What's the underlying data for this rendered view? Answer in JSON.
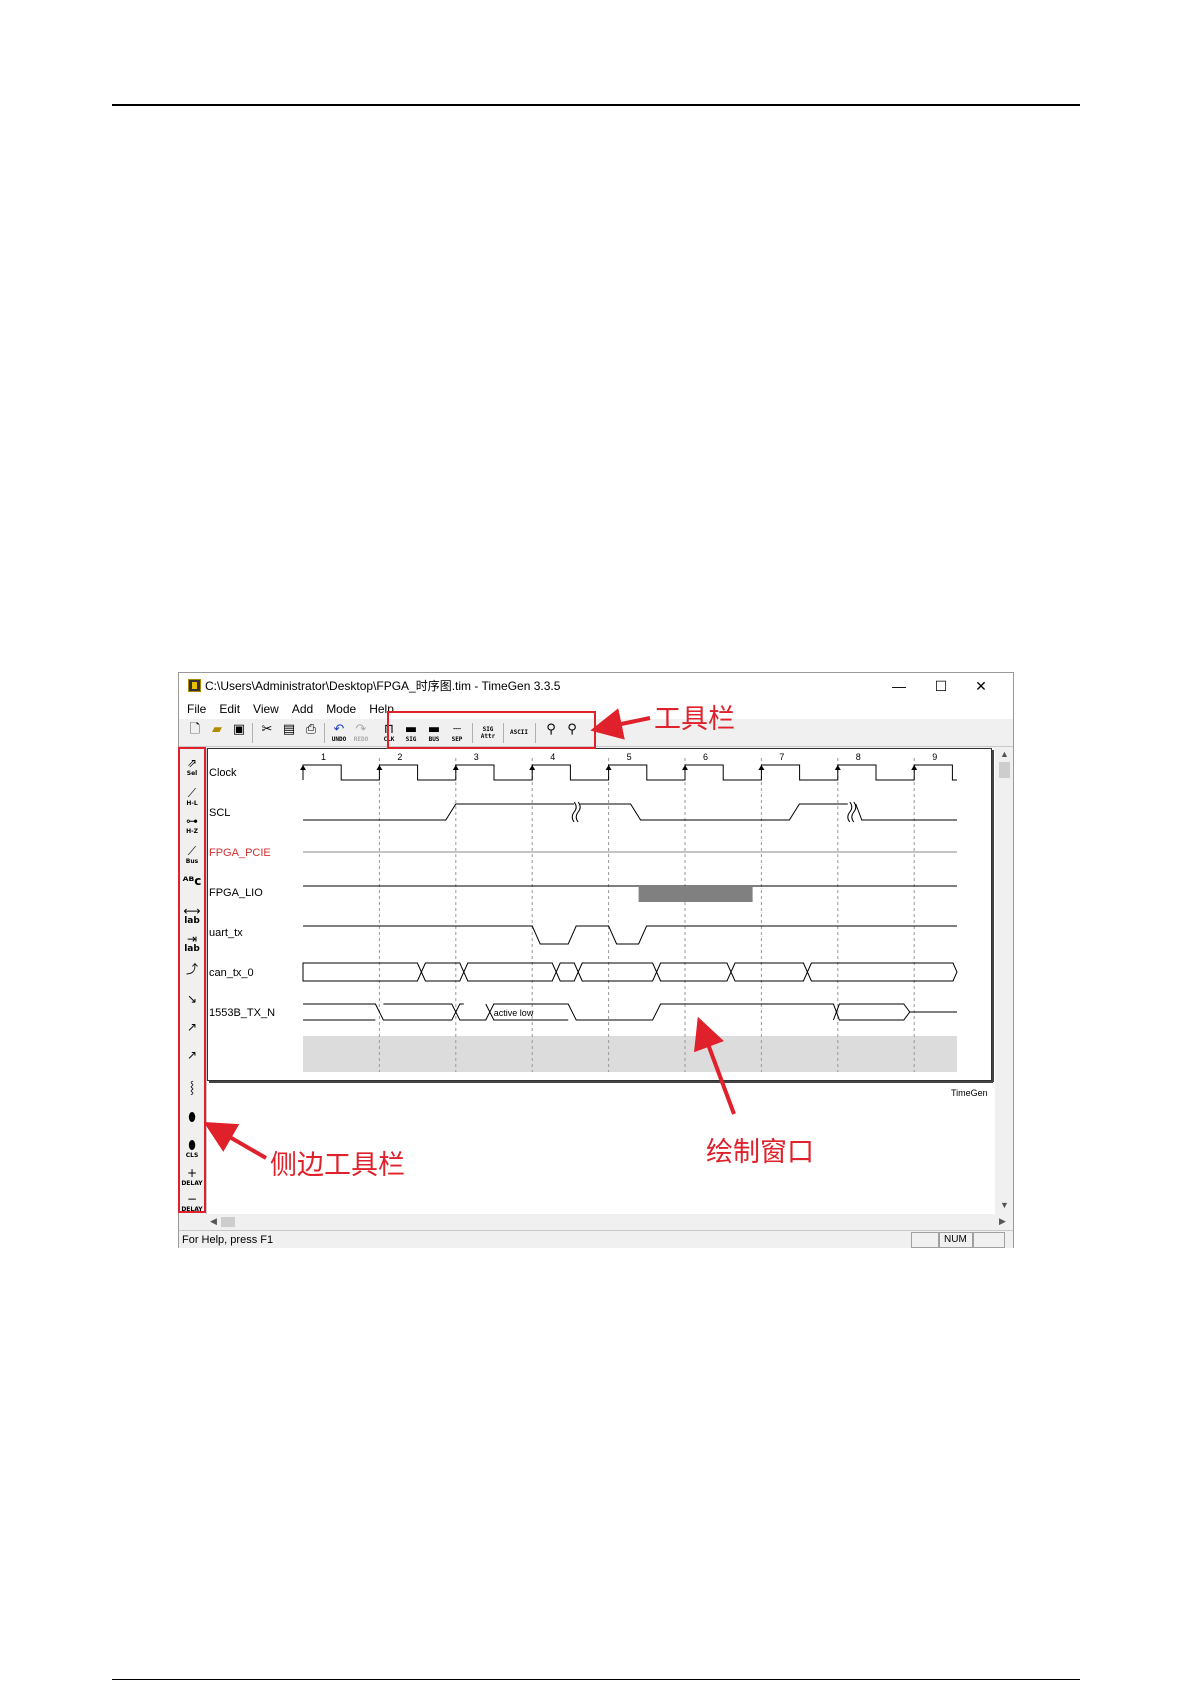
{
  "window": {
    "title": "C:\\Users\\Administrator\\Desktop\\FPGA_时序图.tim - TimeGen 3.3.5",
    "controls": [
      "—",
      "☐",
      "✕"
    ]
  },
  "menu": [
    "File",
    "Edit",
    "View",
    "Add",
    "Mode",
    "Help"
  ],
  "toolbar": {
    "undo": "UNDO",
    "redo": "REDO",
    "clk": "CLK",
    "sig": "SIG",
    "bus": "BUS",
    "sep": "SEP",
    "sig_attr_1": "SIG",
    "sig_attr_2": "Attr",
    "ascii": "ASCII"
  },
  "sidebar": {
    "sel": "Sel",
    "hl": "H-L",
    "hz": "H-Z",
    "bus": "Bus",
    "lab1": "lab",
    "lab2": "lab",
    "cls": "CLS",
    "delay_plus": "DELAY",
    "delay_minus": "DELAY"
  },
  "clock_cycles": [
    "1",
    "2",
    "3",
    "4",
    "5",
    "6",
    "7",
    "8",
    "9"
  ],
  "signals": [
    {
      "name": "Clock",
      "color": "#000000"
    },
    {
      "name": "SCL",
      "color": "#000000"
    },
    {
      "name": "FPGA_PCIE",
      "color": "#d03030"
    },
    {
      "name": "FPGA_LIO",
      "color": "#000000"
    },
    {
      "name": "uart_tx",
      "color": "#000000"
    },
    {
      "name": "can_tx_0",
      "color": "#000000"
    },
    {
      "name": "1553B_TX_N",
      "color": "#000000"
    }
  ],
  "annotation_text": "active low",
  "brand": "TimeGen",
  "status": {
    "help": "For Help, press F1",
    "num": "NUM"
  },
  "annotations": {
    "toolbar_label": "工具栏",
    "sidebar_label": "侧边工具栏",
    "canvas_label": "绘制窗口",
    "accent": "#e0202a"
  }
}
